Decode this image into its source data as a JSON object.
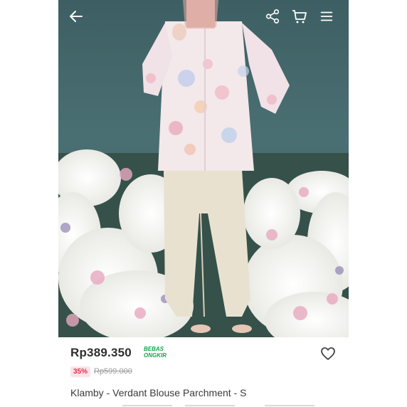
{
  "product": {
    "price": "Rp389.350",
    "free_shipping_badge": [
      "BEBAS",
      "ONGKIR"
    ],
    "discount_badge": "35%",
    "original_price": "Rp599.000",
    "title": "Klamby - Verdant Blouse Parchment - S"
  },
  "icons": {
    "back": "arrow-left-icon",
    "share": "share-icon",
    "cart": "cart-icon",
    "menu": "hamburger-menu-icon",
    "wishlist": "heart-icon"
  },
  "colors": {
    "price_text": "#2e2e2e",
    "free_shipping": "#16a34a",
    "discount_badge_bg": "#fde2e7",
    "discount_badge_text": "#e0324f",
    "strikethrough_price": "#9a9a9a"
  }
}
